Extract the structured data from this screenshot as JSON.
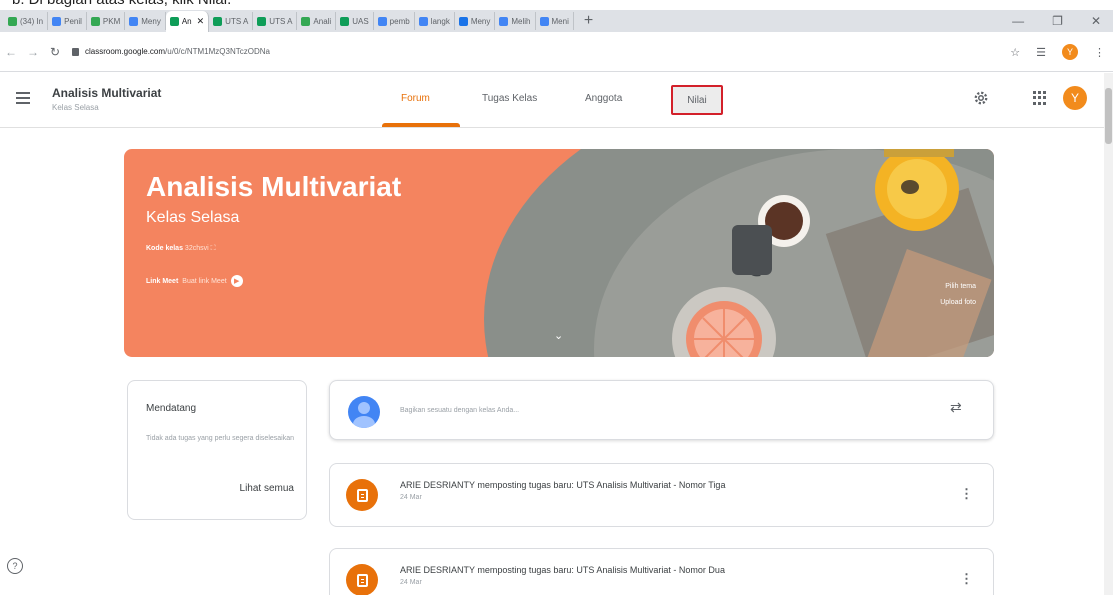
{
  "caption": "b.   Di bagian atas kelas, klik Nilai.",
  "browser": {
    "tabs": [
      {
        "label": "(34) In",
        "color": "#34a853"
      },
      {
        "label": "Penil",
        "color": "#4285f4"
      },
      {
        "label": "PKM",
        "color": "#34a853"
      },
      {
        "label": "Meny",
        "color": "#4285f4"
      },
      {
        "label": "An",
        "color": "#0f9d58",
        "active": true
      },
      {
        "label": "UTS A",
        "color": "#0f9d58"
      },
      {
        "label": "UTS A",
        "color": "#0f9d58"
      },
      {
        "label": "Anali",
        "color": "#34a853"
      },
      {
        "label": "UAS",
        "color": "#0f9d58"
      },
      {
        "label": "pemb",
        "color": "#4285f4"
      },
      {
        "label": "langk",
        "color": "#4285f4"
      },
      {
        "label": "Meny",
        "color": "#1a73e8"
      },
      {
        "label": "Melih",
        "color": "#4285f4"
      },
      {
        "label": "Meni",
        "color": "#4285f4"
      }
    ],
    "url_host": "classroom.google.com",
    "url_path": "/u/0/c/NTM1MzQ3NTczODNa",
    "profile_initial": "Y"
  },
  "header": {
    "class_title": "Analisis Multivariat",
    "class_subtitle": "Kelas Selasa",
    "tabs": {
      "forum": "Forum",
      "classwork": "Tugas Kelas",
      "people": "Anggota",
      "grades": "Nilai"
    },
    "avatar_initial": "Y"
  },
  "banner": {
    "title": "Analisis Multivariat",
    "subtitle": "Kelas Selasa",
    "code_label": "Kode kelas",
    "code_value": "32chsvi",
    "meet_label": "Link Meet",
    "meet_value": "Buat link Meet",
    "photo_label": "Pilih tema",
    "upload_label": "Upload foto"
  },
  "upcoming": {
    "title": "Mendatang",
    "text": "Tidak ada tugas yang perlu segera diselesaikan",
    "link": "Lihat semua"
  },
  "share": {
    "placeholder": "Bagikan sesuatu dengan kelas Anda..."
  },
  "posts": [
    {
      "title": "ARIE DESRIANTY memposting tugas baru: UTS Analisis Multivariat - Nomor Tiga",
      "date": "24 Mar"
    },
    {
      "title": "ARIE DESRIANTY memposting tugas baru: UTS Analisis Multivariat - Nomor Dua",
      "date": "24 Mar"
    }
  ],
  "colors": {
    "accent": "#e8710a",
    "banner": "#f4845f",
    "highlight": "#d3202a"
  }
}
